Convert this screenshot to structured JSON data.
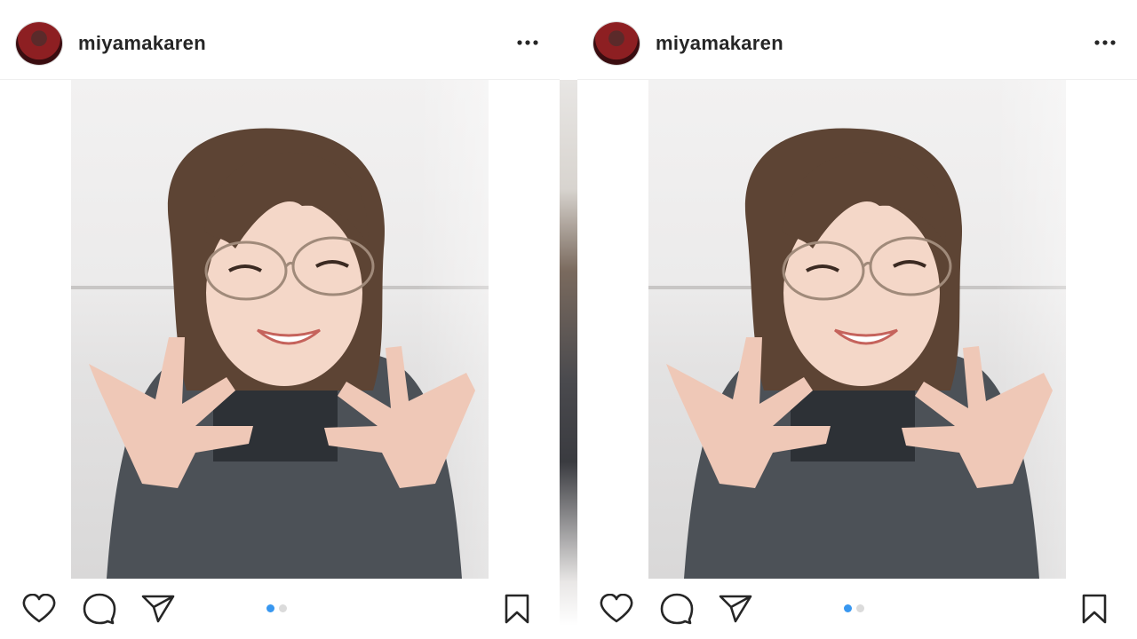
{
  "posts": [
    {
      "username": "miyamakaren",
      "icons": {
        "avatar": "profile-avatar",
        "more": "more-options-icon",
        "like": "heart-icon",
        "comment": "comment-icon",
        "share": "paper-plane-icon",
        "save": "bookmark-icon"
      },
      "carousel": {
        "total": 2,
        "current": 1
      }
    },
    {
      "username": "miyamakaren",
      "icons": {
        "avatar": "profile-avatar",
        "more": "more-options-icon",
        "like": "heart-icon",
        "comment": "comment-icon",
        "share": "paper-plane-icon",
        "save": "bookmark-icon"
      },
      "carousel": {
        "total": 2,
        "current": 1
      }
    }
  ],
  "colors": {
    "username_text": "#262626",
    "active_dot": "#3897f0",
    "inactive_dot": "#dbdbdb",
    "icon_stroke": "#262626"
  }
}
